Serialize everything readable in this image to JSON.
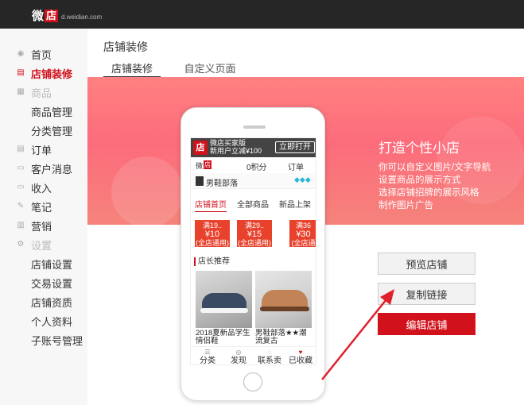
{
  "topbar": {
    "logo_wei": "微",
    "logo_dian": "店",
    "logo_domain": "d.weidian.com"
  },
  "sidebar": {
    "items": [
      {
        "label": "首页",
        "icon": "eye-icon"
      },
      {
        "label": "店铺装修",
        "icon": "store-icon"
      },
      {
        "label": "商品",
        "icon": "goods-icon"
      },
      {
        "label": "商品管理"
      },
      {
        "label": "分类管理"
      },
      {
        "label": "订单",
        "icon": "order-icon"
      },
      {
        "label": "客户消息",
        "icon": "message-icon"
      },
      {
        "label": "收入",
        "icon": "folder-icon"
      },
      {
        "label": "笔记",
        "icon": "note-icon"
      },
      {
        "label": "营销",
        "icon": "marketing-icon"
      },
      {
        "label": "设置",
        "icon": "gear-icon"
      },
      {
        "label": "店铺设置"
      },
      {
        "label": "交易设置"
      },
      {
        "label": "店铺资质"
      },
      {
        "label": "个人资料"
      },
      {
        "label": "子账号管理"
      }
    ]
  },
  "main": {
    "page_title": "店铺装修",
    "tabs": [
      {
        "label": "店铺装修"
      },
      {
        "label": "自定义页面"
      }
    ]
  },
  "promo": {
    "title": "打造个性小店",
    "lines": [
      "你可以自定义图片/文字导航",
      "设置商品的展示方式",
      "选择店铺招牌的展示风格",
      "制作图片广告"
    ]
  },
  "buttons": {
    "preview": "预览店铺",
    "copy": "复制链接",
    "edit": "编辑店铺"
  },
  "phone": {
    "app_icon": "店",
    "app_line1": "微店买家版",
    "app_line2": "新用户立减¥100",
    "open_btn": "立即打开",
    "shop_wei": "微",
    "shop_dian": "店",
    "points": "0积分",
    "orders": "订单",
    "shop_name": "男鞋部落",
    "shop_tabs": [
      "店铺首页",
      "全部商品",
      "新品上架"
    ],
    "coupons": [
      {
        "cond": "满19..",
        "val": "¥10",
        "scope": "(全店通用)"
      },
      {
        "cond": "满29..",
        "val": "¥15",
        "scope": "(全店通用)"
      },
      {
        "cond": "满36",
        "val": "¥30",
        "scope": "(全店通用)"
      }
    ],
    "section_title": "店长推荐",
    "products": [
      {
        "name": "2018夏新品学生情侣鞋"
      },
      {
        "name": "男鞋部落★★潮流复古"
      }
    ],
    "bottom_nav": [
      {
        "label": "分类",
        "icon": "grid-icon"
      },
      {
        "label": "发现",
        "icon": "compass-icon"
      },
      {
        "label": "联系卖家",
        "icon": "chat-icon"
      },
      {
        "label": "已收藏",
        "icon": "heart-icon"
      }
    ]
  }
}
